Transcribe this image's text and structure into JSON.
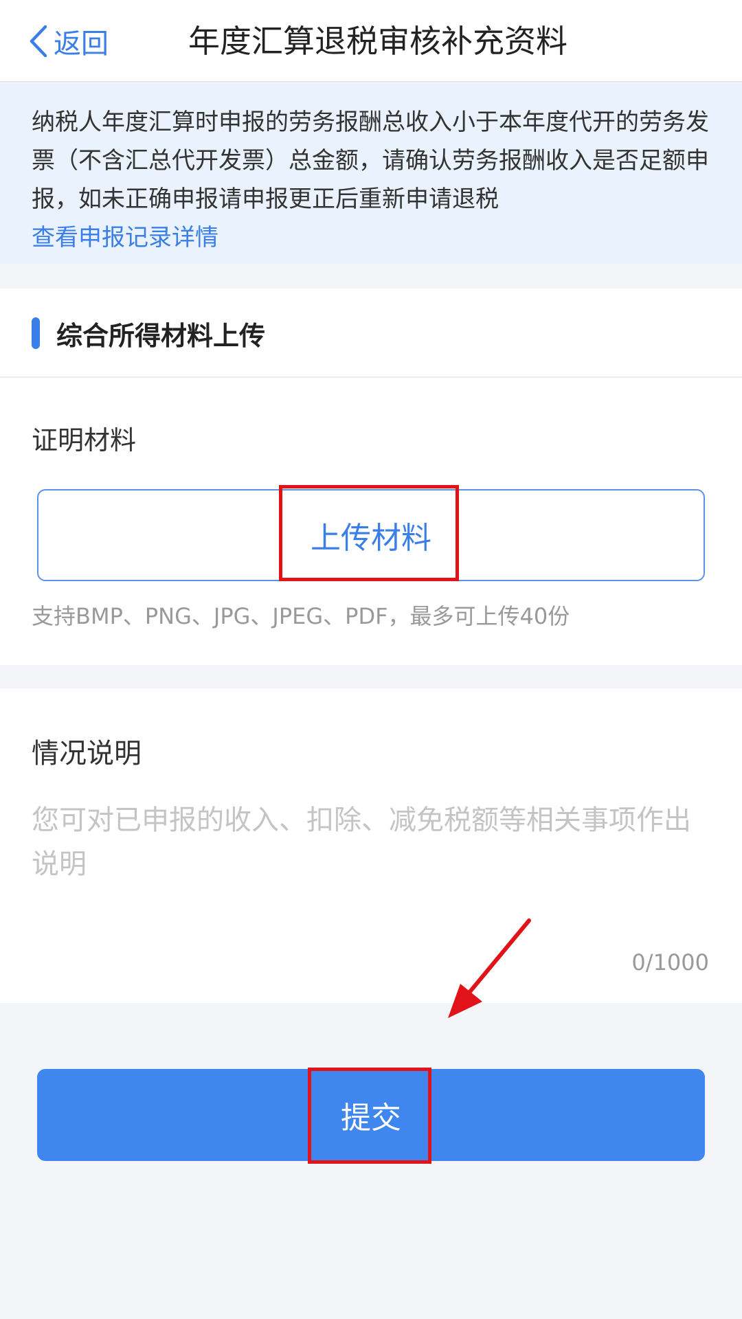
{
  "header": {
    "back_label": "返回",
    "title": "年度汇算退税审核补充资料"
  },
  "notice": {
    "text": "纳税人年度汇算时申报的劳务报酬总收入小于本年度代开的劳务发票（不含汇总代开发票）总金额，请确认劳务报酬收入是否足额申报，如未正确申报请申报更正后重新申请退税",
    "link": "查看申报记录详情"
  },
  "upload_section": {
    "title": "综合所得材料上传",
    "field_label": "证明材料",
    "upload_label": "上传材料",
    "hint": "支持BMP、PNG、JPG、JPEG、PDF，最多可上传40份"
  },
  "description": {
    "label": "情况说明",
    "placeholder": "您可对已申报的收入、扣除、减免税额等相关事项作出说明",
    "value": "",
    "counter": "0/1000"
  },
  "submit": {
    "label": "提交"
  },
  "colors": {
    "accent": "#3a7ee8",
    "submit_bg": "#3f87ee",
    "notice_bg": "#eaf3fd",
    "annotation_red": "#e11218"
  },
  "icons": {
    "back": "chevron-left-icon"
  }
}
